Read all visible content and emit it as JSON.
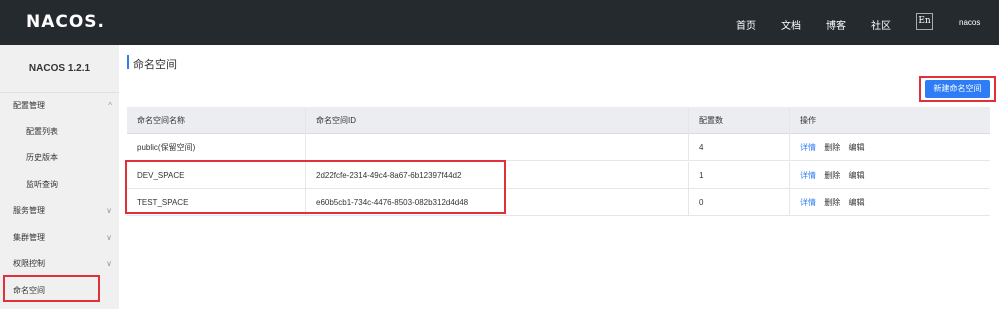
{
  "app": {
    "logo": "NACOS.",
    "nav": {
      "home": "首页",
      "docs": "文档",
      "blog": "博客",
      "community": "社区",
      "lang": "En",
      "user": "nacos"
    }
  },
  "sidebar": {
    "version": "NACOS 1.2.1",
    "items": [
      {
        "label": "配置管理",
        "chevron": "chevron-up-icon"
      },
      {
        "label": "配置列表"
      },
      {
        "label": "历史版本"
      },
      {
        "label": "监听查询"
      },
      {
        "label": "服务管理",
        "chevron": "chevron-down-icon"
      },
      {
        "label": "集群管理",
        "chevron": "chevron-down-icon"
      },
      {
        "label": "权限控制",
        "chevron": "chevron-down-icon"
      },
      {
        "label": "命名空间"
      }
    ]
  },
  "main": {
    "title": "命名空间",
    "create_button": "新建命名空间",
    "table": {
      "headers": [
        "命名空间名称",
        "命名空间ID",
        "配置数",
        "操作"
      ],
      "rows": [
        {
          "name": "public(保留空间)",
          "id": "",
          "count": "4"
        },
        {
          "name": "DEV_SPACE",
          "id": "2d22fcfe-2314-49c4-8a67-6b12397f44d2",
          "count": "1"
        },
        {
          "name": "TEST_SPACE",
          "id": "e60b5cb1-734c-4476-8503-082b312d4d48",
          "count": "0"
        }
      ],
      "actions": {
        "detail": "详情",
        "delete": "删除",
        "edit": "编辑"
      }
    }
  },
  "colors": {
    "accent": "#2e7cf6",
    "topbar": "#252a2f",
    "highlight": "#e0303a"
  }
}
